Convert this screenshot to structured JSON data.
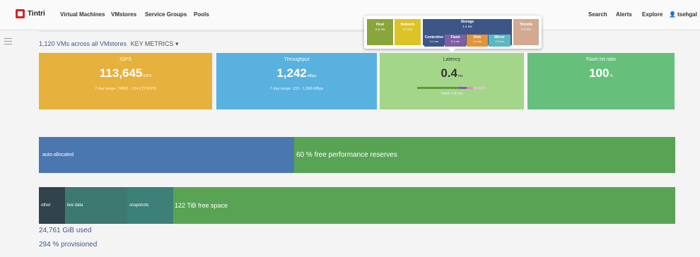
{
  "app": {
    "name": "Tintri"
  },
  "nav": {
    "items": [
      "Virtual Machines",
      "VMstores",
      "Service Groups",
      "Pools"
    ]
  },
  "nav_right": {
    "search": "Search",
    "alerts": "Alerts",
    "explore": "Explore",
    "user": "tsehgal"
  },
  "summary": {
    "text": "1,120 VMs across all VMstores",
    "metrics_label": "KEY METRICS",
    "caret": "▾"
  },
  "metrics": {
    "iops": {
      "title": "IOPS",
      "value": "113,645",
      "unit": "IOPS",
      "sub": "7 day range: 74892 - 124,173 IOPS"
    },
    "throughput": {
      "title": "Throughput",
      "value": "1,242",
      "unit": "MBps",
      "sub": "7 day range: 133 - 1,368 MBps"
    },
    "latency": {
      "title": "Latency",
      "value": "0.4",
      "unit": "ms",
      "sub": "Total: 3.8 ms"
    },
    "flash": {
      "title": "Flash hit ratio",
      "value": "100",
      "unit": "%"
    }
  },
  "latency_popup": {
    "host": {
      "label": "Host",
      "value": "2.6 ms"
    },
    "network": {
      "label": "Network",
      "value": "0.1 ms"
    },
    "storage": {
      "label": "Storage",
      "value": "1.4 ms"
    },
    "contention": {
      "label": "Contention",
      "value": "0.0 ms"
    },
    "flash": {
      "label": "Flash",
      "value": "0.4 ms"
    },
    "disk": {
      "label": "Disk",
      "value": "1.0 ms"
    },
    "mirror": {
      "label": "Mirror",
      "value": "0.0 ms"
    },
    "throttle": {
      "label": "Throttle",
      "value": "0.0 ms"
    }
  },
  "performance_bar": {
    "allocated_label": "auto-allocated",
    "free_label": "60 % free performance reserves",
    "free_fraction": 0.6
  },
  "capacity_bar": {
    "other_label": "other",
    "live_label": "live data",
    "snapshots_label": "snapshots",
    "free_label": "122 TiB free space"
  },
  "footer": {
    "used": "24,761 GiB used",
    "provisioned": "294 % provisioned"
  },
  "colors": {
    "iops": "#e6b13c",
    "throughput": "#58b1df",
    "latency": "#a4d68a",
    "flash": "#66c07b",
    "allocated": "#4a77b0",
    "free": "#59a454",
    "brand": "#d6232a"
  }
}
